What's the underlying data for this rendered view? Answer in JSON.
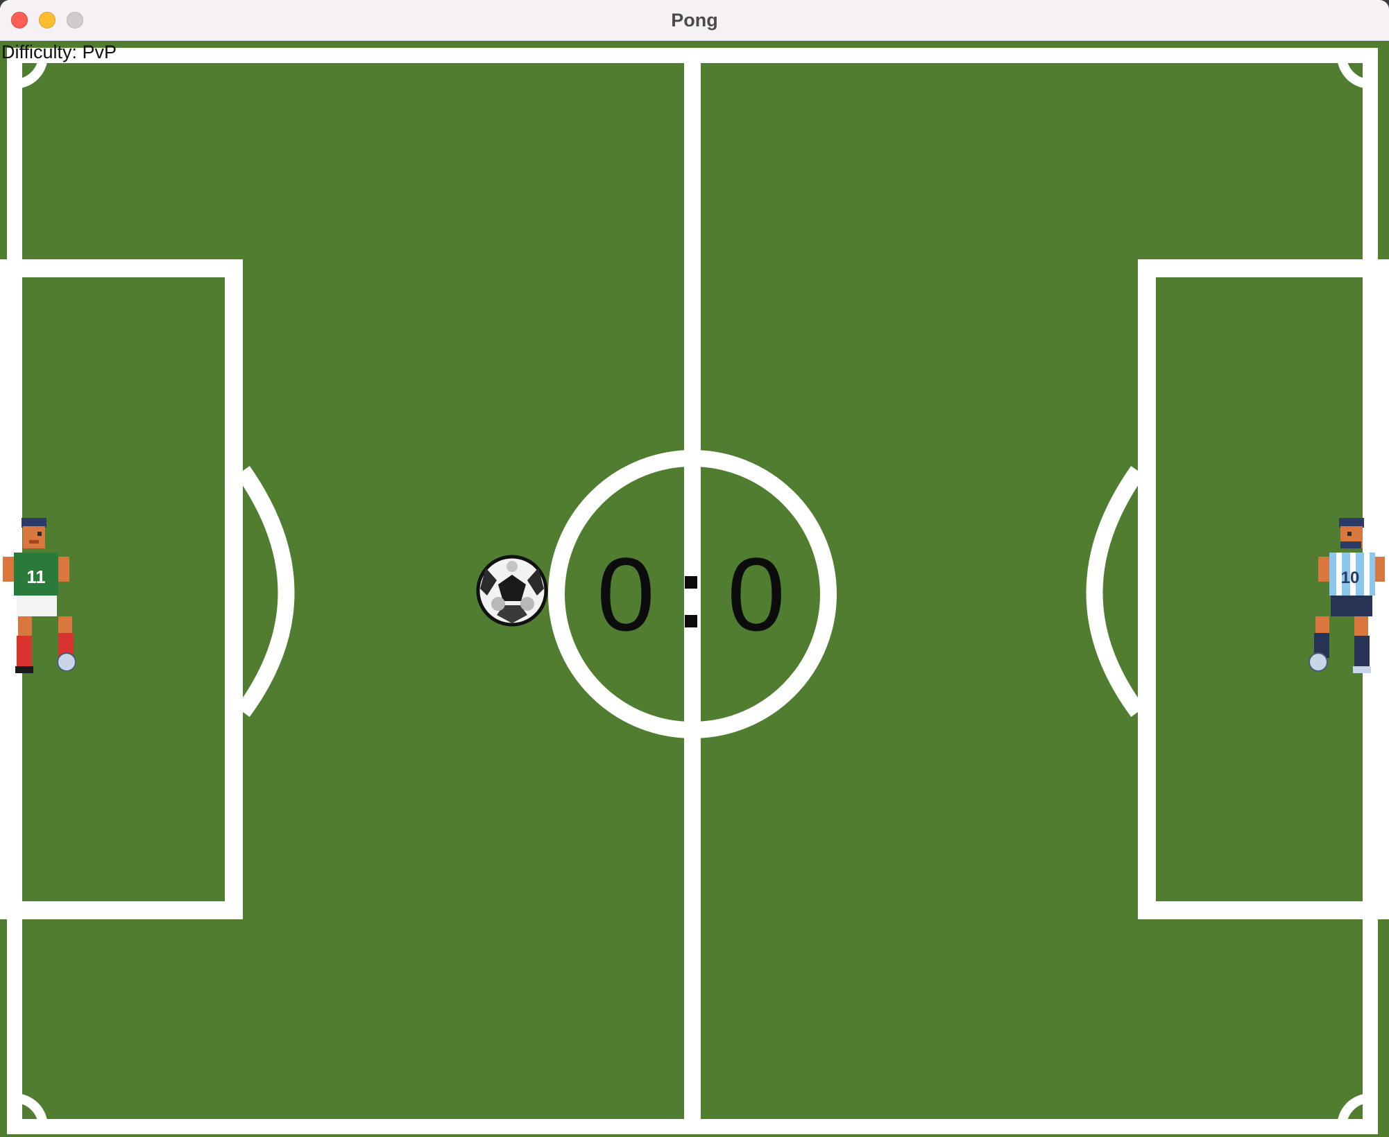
{
  "window": {
    "title": "Pong"
  },
  "hud": {
    "difficulty": "Difficulty: PvP"
  },
  "score": {
    "left": "0",
    "separator": ":",
    "right": "0"
  },
  "colors": {
    "pitch": "#507d30",
    "lines": "#ffffff",
    "score": "#0c0c0c",
    "left_kit": "#2a7a3c",
    "right_kit": "#8cc8ee"
  },
  "icons": {
    "ball": "soccer-ball-icon",
    "left_player": "player-11-icon",
    "right_player": "player-10-icon"
  },
  "players": {
    "left_number": "11",
    "right_number": "10"
  }
}
